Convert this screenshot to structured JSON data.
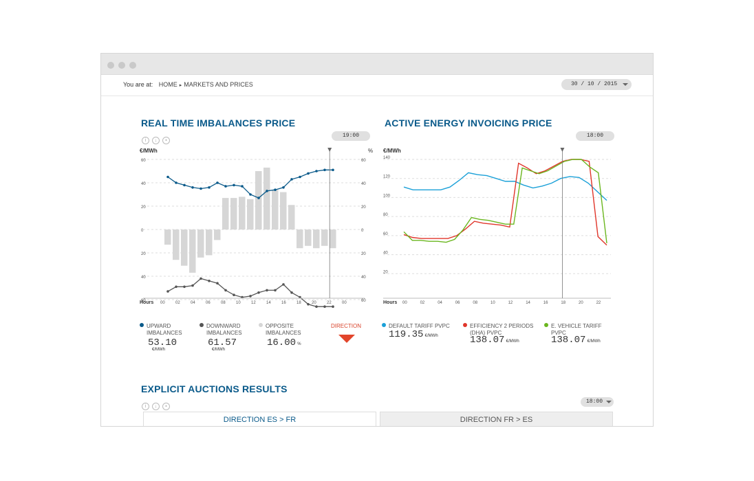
{
  "breadcrumb": {
    "prefix": "You are at:",
    "items": [
      "HOME",
      "MARKETS AND PRICES"
    ]
  },
  "date_picker": {
    "value": "30 / 10 / 2015"
  },
  "left_panel": {
    "title": "REAL TIME IMBALANCES PRICE",
    "time": "19:00",
    "icons": [
      "info-icon",
      "download-icon",
      "chart-icon"
    ],
    "direction_label": "DIRECTION",
    "legend": [
      {
        "label_lines": [
          "UPWARD",
          "IMBALANCES"
        ],
        "value": "53.10",
        "unit": "€/MWh",
        "color": "#0a5a8a"
      },
      {
        "label_lines": [
          "DOWNWARD",
          "IMBALANCES"
        ],
        "value": "61.57",
        "unit": "€/MWh",
        "color": "#555555"
      },
      {
        "label_lines": [
          "OPPOSITE",
          "IMBALANCES"
        ],
        "value": "16.00",
        "unit": "%",
        "color": "#d6d6d6"
      }
    ]
  },
  "right_panel": {
    "title": "ACTIVE ENERGY INVOICING PRICE",
    "time": "18:00",
    "legend": [
      {
        "label_lines": [
          "DEFAULT TARIFF PVPC"
        ],
        "value": "119.35",
        "unit": "€/MWh",
        "color": "#1aa0d8"
      },
      {
        "label_lines": [
          "EFFICIENCY 2 PERIODS",
          "(DHA) PVPC"
        ],
        "value": "138.07",
        "unit": "€/MWh",
        "color": "#e0352a"
      },
      {
        "label_lines": [
          "E. VEHICLE TARIFF",
          "PVPC"
        ],
        "value": "138.07",
        "unit": "€/MWh",
        "color": "#6ab61e"
      }
    ]
  },
  "auctions": {
    "title": "EXPLICIT AUCTIONS RESULTS",
    "time": "18:00",
    "tabs": [
      "DIRECTION ES > FR",
      "DIRECTION FR > ES"
    ]
  },
  "chart_data": [
    {
      "type": "line",
      "title": "REAL TIME IMBALANCES PRICE",
      "xlabel": "Hours",
      "ylabel_left": "€/MWh",
      "ylabel_right": "%",
      "x_ticks": [
        "00",
        "02",
        "04",
        "06",
        "08",
        "10",
        "12",
        "14",
        "16",
        "18",
        "20",
        "22",
        "00"
      ],
      "y_ticks_top": [
        "60",
        "40",
        "20",
        "0"
      ],
      "y_ticks_bottom": [
        "20",
        "40",
        "60"
      ],
      "current_hour": 19,
      "grid": true,
      "bars_series": {
        "name": "OPPOSITE IMBALANCES",
        "color": "#d6d6d6",
        "values": [
          -13,
          -26,
          -31,
          -37,
          -24,
          -22,
          -9,
          27,
          27,
          28,
          26,
          50,
          53,
          34,
          32,
          21,
          -16,
          -14,
          -16,
          -14,
          -16
        ]
      },
      "series": [
        {
          "name": "UPWARD IMBALANCES",
          "color": "#0a5a8a",
          "region": "top",
          "values": [
            45,
            40,
            38,
            36,
            35,
            36,
            40,
            37,
            38,
            37,
            30,
            27,
            33,
            34,
            36,
            43,
            45,
            48,
            50,
            51,
            51
          ]
        },
        {
          "name": "DOWNWARD IMBALANCES",
          "color": "#555555",
          "region": "bottom",
          "values": [
            -53,
            -49,
            -49,
            -48,
            -42,
            -44,
            -46,
            -52,
            -56,
            -58,
            -57,
            -54,
            -52,
            -52,
            -47,
            -54,
            -58,
            -64,
            -66,
            -66,
            -66
          ]
        }
      ]
    },
    {
      "type": "line",
      "title": "ACTIVE ENERGY INVOICING PRICE",
      "xlabel": "Hours",
      "ylabel": "€/MWh",
      "x_ticks": [
        "00",
        "02",
        "04",
        "06",
        "08",
        "10",
        "12",
        "14",
        "16",
        "18",
        "20",
        "22"
      ],
      "ylim": [
        0,
        140
      ],
      "y_ticks": [
        20,
        40,
        60,
        80,
        100,
        120,
        140
      ],
      "current_hour": 18,
      "grid": true,
      "series": [
        {
          "name": "DEFAULT TARIFF PVPC",
          "color": "#1aa0d8",
          "values": [
            111,
            108,
            108,
            108,
            108,
            111,
            118,
            126,
            124,
            123,
            120,
            117,
            117,
            113,
            110,
            112,
            115,
            120,
            122,
            121,
            115,
            106,
            97
          ]
        },
        {
          "name": "EFFICIENCY 2 PERIODS (DHA) PVPC",
          "color": "#e0352a",
          "values": [
            61,
            58,
            57,
            57,
            57,
            57,
            60,
            67,
            75,
            73,
            72,
            71,
            69,
            136,
            131,
            125,
            128,
            133,
            138,
            140,
            140,
            138,
            59,
            50
          ]
        },
        {
          "name": "E. VEHICLE TARIFF PVPC",
          "color": "#6ab61e",
          "values": [
            64,
            55,
            55,
            54,
            54,
            53,
            56,
            66,
            79,
            77,
            76,
            74,
            72,
            72,
            131,
            128,
            125,
            128,
            133,
            138,
            140,
            140,
            132,
            126,
            52
          ]
        }
      ]
    }
  ]
}
